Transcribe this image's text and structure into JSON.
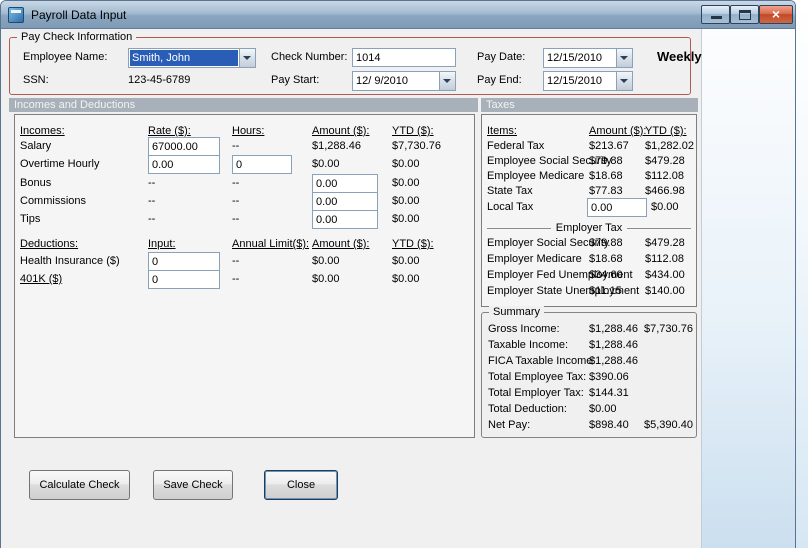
{
  "window": {
    "title": "Payroll Data Input"
  },
  "icons": {
    "close_glyph": "×"
  },
  "colors": {
    "titlebar_top": "#C9D8E6",
    "titlebar_bottom": "#7E9AB6",
    "close_button_red": "#C04A28",
    "paycheck_border_red": "#B25A52",
    "section_header_bg": "#A8B1BA",
    "selection_blue": "#2A5DB5",
    "form_background": "#F0F0F0"
  },
  "paycheck": {
    "group_label": "Pay Check Information",
    "frequency": "Weekly",
    "fields": {
      "employee_name": {
        "label": "Employee Name:",
        "value": "Smith, John"
      },
      "ssn": {
        "label": "SSN:",
        "value": "123-45-6789"
      },
      "check_number": {
        "label": "Check Number:",
        "value": "1014"
      },
      "pay_start": {
        "label": "Pay Start:",
        "value": "12/ 9/2010"
      },
      "pay_date": {
        "label": "Pay Date:",
        "value": "12/15/2010"
      },
      "pay_end": {
        "label": "Pay End:",
        "value": "12/15/2010"
      }
    }
  },
  "sections": {
    "incomes_deductions": "Incomes and Deductions",
    "taxes": "Taxes"
  },
  "incomes": {
    "headers": {
      "name": "Incomes:",
      "rate": "Rate ($):",
      "hours": "Hours:",
      "amount": "Amount ($):",
      "ytd": "YTD ($):"
    },
    "rows": [
      {
        "name": "Salary",
        "rate": "67000.00",
        "hours": "--",
        "amount": "$1,288.46",
        "ytd": "$7,730.76"
      },
      {
        "name": "Overtime Hourly",
        "rate": "0.00",
        "hours": "0",
        "amount": "$0.00",
        "ytd": "$0.00"
      },
      {
        "name": "Bonus",
        "rate": "--",
        "hours": "--",
        "amount": "0.00",
        "ytd": "$0.00"
      },
      {
        "name": "Commissions",
        "rate": "--",
        "hours": "--",
        "amount": "0.00",
        "ytd": "$0.00"
      },
      {
        "name": "Tips",
        "rate": "--",
        "hours": "--",
        "amount": "0.00",
        "ytd": "$0.00"
      }
    ]
  },
  "deductions": {
    "headers": {
      "name": "Deductions:",
      "input": "Input:",
      "limit": "Annual Limit($):",
      "amount": "Amount ($):",
      "ytd": "YTD ($):"
    },
    "rows": [
      {
        "name": "Health Insurance ($)",
        "input": "0",
        "limit": "--",
        "amount": "$0.00",
        "ytd": "$0.00"
      },
      {
        "name": "401K ($)",
        "input": "0",
        "limit": "--",
        "amount": "$0.00",
        "ytd": "$0.00"
      }
    ]
  },
  "taxes": {
    "headers": {
      "item": "Items:",
      "amount": "Amount ($):",
      "ytd": "YTD ($):"
    },
    "employee_rows": [
      {
        "item": "Federal Tax",
        "amount": "$213.67",
        "ytd": "$1,282.02"
      },
      {
        "item": "Employee Social Security",
        "amount": "$79.88",
        "ytd": "$479.28"
      },
      {
        "item": "Employee Medicare",
        "amount": "$18.68",
        "ytd": "$112.08"
      },
      {
        "item": "State Tax",
        "amount": "$77.83",
        "ytd": "$466.98"
      },
      {
        "item": "Local Tax",
        "amount": "0.00",
        "ytd": "$0.00"
      }
    ],
    "employer_label": "Employer Tax",
    "employer_rows": [
      {
        "item": "Employer Social Security",
        "amount": "$79.88",
        "ytd": "$479.28"
      },
      {
        "item": "Employer Medicare",
        "amount": "$18.68",
        "ytd": "$112.08"
      },
      {
        "item": "Employer Fed Unemployment",
        "amount": "$34.60",
        "ytd": "$434.00"
      },
      {
        "item": "Employer State Unemployment",
        "amount": "$11.15",
        "ytd": "$140.00"
      }
    ]
  },
  "summary": {
    "group_label": "Summary",
    "rows": [
      {
        "label": "Gross Income:",
        "amount": "$1,288.46",
        "ytd": "$7,730.76"
      },
      {
        "label": "Taxable Income:",
        "amount": "$1,288.46",
        "ytd": ""
      },
      {
        "label": "FICA Taxable Income:",
        "amount": "$1,288.46",
        "ytd": ""
      },
      {
        "label": "Total Employee Tax:",
        "amount": "$390.06",
        "ytd": ""
      },
      {
        "label": "Total Employer Tax:",
        "amount": "$144.31",
        "ytd": ""
      },
      {
        "label": "Total Deduction:",
        "amount": "$0.00",
        "ytd": ""
      },
      {
        "label": "Net Pay:",
        "amount": "$898.40",
        "ytd": "$5,390.40"
      }
    ]
  },
  "buttons": {
    "calculate": "Calculate Check",
    "save": "Save Check",
    "close": "Close"
  }
}
